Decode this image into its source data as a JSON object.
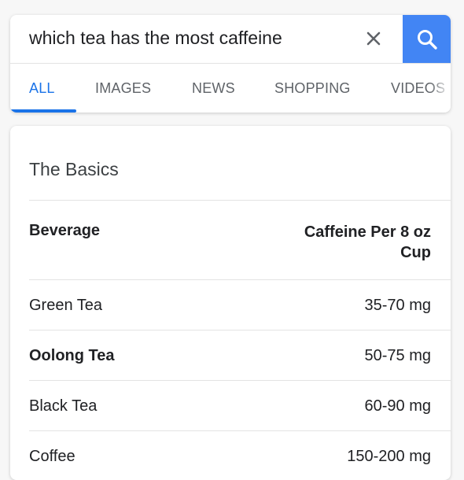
{
  "search": {
    "query": "which tea has the most caffeine",
    "clear_icon": "close-icon",
    "search_icon": "magnifier-icon",
    "accent_color": "#4285f4"
  },
  "tabs": [
    {
      "label": "ALL",
      "active": true
    },
    {
      "label": "IMAGES",
      "active": false
    },
    {
      "label": "NEWS",
      "active": false
    },
    {
      "label": "SHOPPING",
      "active": false
    },
    {
      "label": "VIDEOS",
      "active": false
    }
  ],
  "basics": {
    "title": "The Basics",
    "headers": {
      "beverage": "Beverage",
      "caffeine": "Caffeine Per 8 oz Cup"
    },
    "rows": [
      {
        "beverage": "Green Tea",
        "caffeine": "35-70 mg",
        "bold": false
      },
      {
        "beverage": "Oolong Tea",
        "caffeine": "50-75 mg",
        "bold": true
      },
      {
        "beverage": "Black Tea",
        "caffeine": "60-90 mg",
        "bold": false
      },
      {
        "beverage": "Coffee",
        "caffeine": "150-200 mg",
        "bold": false
      }
    ]
  }
}
